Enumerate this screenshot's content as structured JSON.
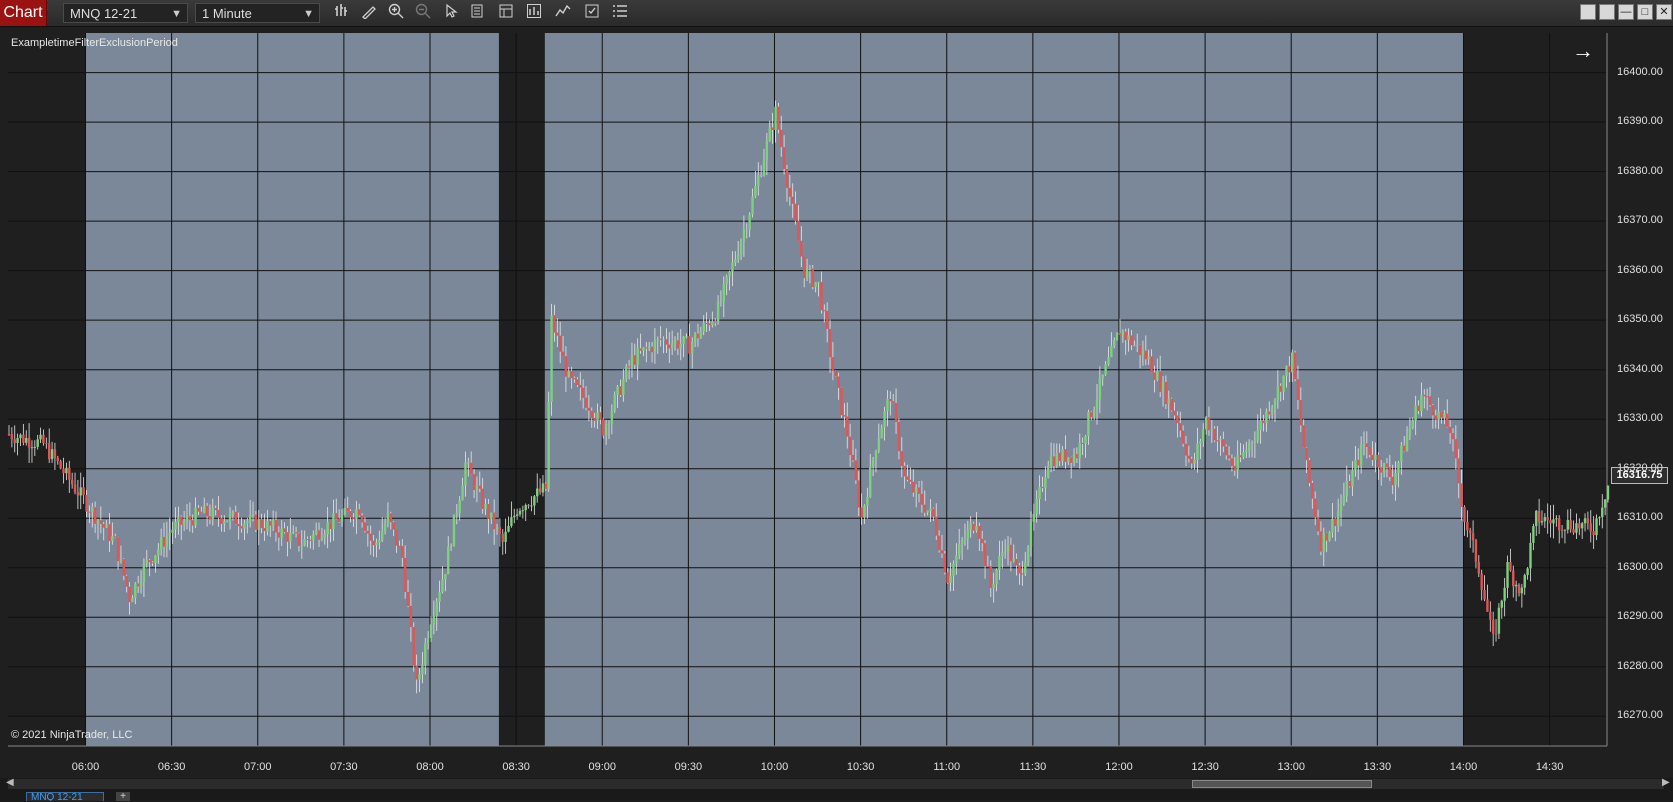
{
  "toolbar": {
    "chart_label": "Chart",
    "instrument": "MNQ 12-21",
    "timeframe": "1 Minute",
    "icons": [
      "bars-type-icon",
      "drawing-tool-icon",
      "zoom-in-icon",
      "zoom-out-icon",
      "pointer-icon",
      "data-box-icon",
      "properties-icon",
      "strategies-icon",
      "indicators-icon",
      "templates-icon",
      "menu-icon"
    ]
  },
  "window_controls": [
    "tile-icon",
    "tile-alt-icon",
    "minimize-icon",
    "maximize-icon",
    "close-icon"
  ],
  "chart": {
    "indicator_label": "ExampletimeFilterExclusionPeriod",
    "copyright": "© 2021 NinjaTrader, LLC",
    "last_price": "16316.75",
    "colors": {
      "background": "#1f1f1f",
      "session_shade": "#7a8899",
      "grid": "#101010",
      "up": "#7ed07e",
      "down": "#e05555",
      "wick": "#e8e8e8"
    }
  },
  "chart_data": {
    "type": "candlestick",
    "x_tick_labels": [
      "06:00",
      "06:30",
      "07:00",
      "07:30",
      "08:00",
      "08:30",
      "09:00",
      "09:30",
      "10:00",
      "10:30",
      "11:00",
      "11:30",
      "12:00",
      "12:30",
      "13:00",
      "13:30",
      "14:00",
      "14:30"
    ],
    "y_tick_labels": [
      "16400.00",
      "16390.00",
      "16380.00",
      "16370.00",
      "16360.00",
      "16350.00",
      "16340.00",
      "16330.00",
      "16320.00",
      "16310.00",
      "16300.00",
      "16290.00",
      "16280.00",
      "16270.00"
    ],
    "ylim": [
      16264,
      16408
    ],
    "xlim": [
      "05:33",
      "14:50"
    ],
    "shaded_periods": [
      [
        "06:00",
        "08:24"
      ],
      [
        "08:40",
        "14:00"
      ]
    ],
    "price_path": [
      [
        "05:33",
        16327
      ],
      [
        "05:45",
        16325
      ],
      [
        "06:00",
        16313
      ],
      [
        "06:10",
        16305
      ],
      [
        "06:15",
        16294
      ],
      [
        "06:20",
        16300
      ],
      [
        "06:30",
        16308
      ],
      [
        "06:40",
        16311
      ],
      [
        "06:50",
        16310
      ],
      [
        "07:00",
        16309
      ],
      [
        "07:05",
        16308
      ],
      [
        "07:15",
        16305
      ],
      [
        "07:25",
        16309
      ],
      [
        "07:35",
        16312
      ],
      [
        "07:40",
        16304
      ],
      [
        "07:45",
        16310
      ],
      [
        "07:50",
        16302
      ],
      [
        "07:55",
        16276
      ],
      [
        "08:00",
        16290
      ],
      [
        "08:05",
        16300
      ],
      [
        "08:12",
        16321
      ],
      [
        "08:18",
        16313
      ],
      [
        "08:25",
        16305
      ],
      [
        "08:30",
        16312
      ],
      [
        "08:40",
        16316
      ],
      [
        "08:42",
        16350
      ],
      [
        "08:48",
        16338
      ],
      [
        "08:55",
        16333
      ],
      [
        "09:00",
        16328
      ],
      [
        "09:10",
        16342
      ],
      [
        "09:20",
        16346
      ],
      [
        "09:30",
        16345
      ],
      [
        "09:40",
        16352
      ],
      [
        "09:50",
        16370
      ],
      [
        "10:00",
        16392
      ],
      [
        "10:05",
        16375
      ],
      [
        "10:10",
        16360
      ],
      [
        "10:15",
        16357
      ],
      [
        "10:20",
        16340
      ],
      [
        "10:25",
        16327
      ],
      [
        "10:30",
        16310
      ],
      [
        "10:35",
        16325
      ],
      [
        "10:40",
        16335
      ],
      [
        "10:45",
        16318
      ],
      [
        "10:55",
        16310
      ],
      [
        "11:00",
        16298
      ],
      [
        "11:05",
        16305
      ],
      [
        "11:10",
        16310
      ],
      [
        "11:15",
        16296
      ],
      [
        "11:20",
        16305
      ],
      [
        "11:25",
        16298
      ],
      [
        "11:35",
        16322
      ],
      [
        "11:45",
        16323
      ],
      [
        "11:55",
        16340
      ],
      [
        "12:00",
        16348
      ],
      [
        "12:10",
        16342
      ],
      [
        "12:20",
        16330
      ],
      [
        "12:25",
        16320
      ],
      [
        "12:30",
        16330
      ],
      [
        "12:40",
        16320
      ],
      [
        "12:50",
        16330
      ],
      [
        "13:00",
        16342
      ],
      [
        "13:05",
        16320
      ],
      [
        "13:10",
        16305
      ],
      [
        "13:15",
        16310
      ],
      [
        "13:25",
        16325
      ],
      [
        "13:35",
        16318
      ],
      [
        "13:45",
        16335
      ],
      [
        "13:55",
        16328
      ],
      [
        "14:00",
        16310
      ],
      [
        "14:05",
        16300
      ],
      [
        "14:10",
        16285
      ],
      [
        "14:15",
        16300
      ],
      [
        "14:20",
        16295
      ],
      [
        "14:25",
        16310
      ],
      [
        "14:35",
        16309
      ],
      [
        "14:45",
        16308
      ],
      [
        "14:50",
        16316.75
      ]
    ]
  }
}
